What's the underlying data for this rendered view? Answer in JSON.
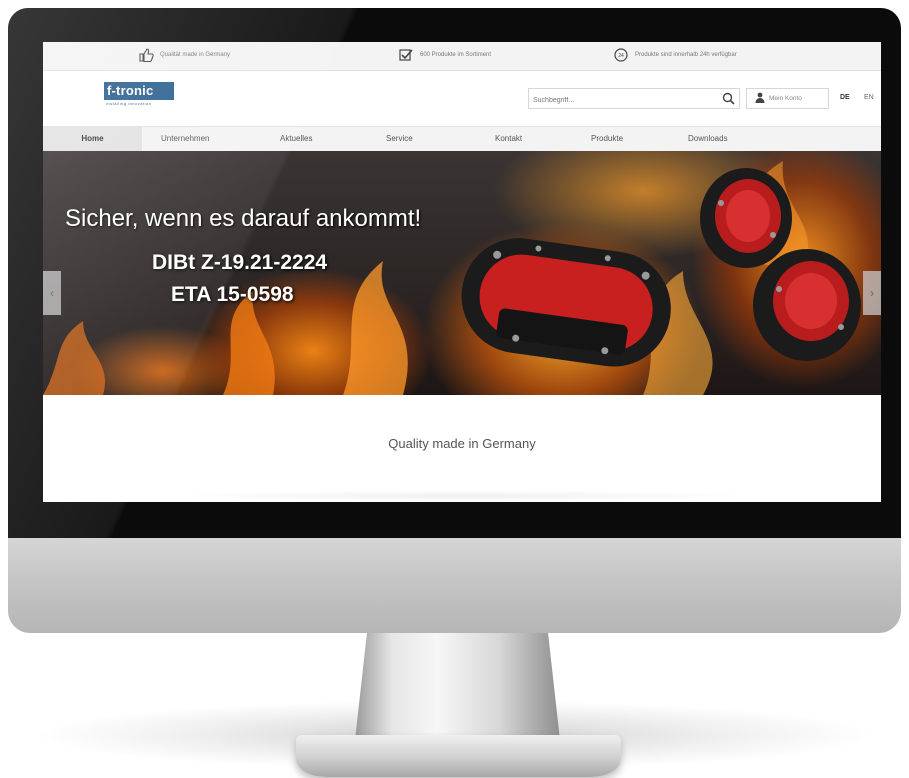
{
  "usps": [
    {
      "icon": "thumbs-up-icon",
      "text": "Qualität made in Germany"
    },
    {
      "icon": "checkbox-icon",
      "text": "600 Produkte im Sortiment"
    },
    {
      "icon": "clock-24h-icon",
      "text": "Produkte sind innerhalb 24h verfügbar"
    }
  ],
  "header": {
    "logo_text": "f-tronic",
    "logo_sub": "installing innovation",
    "search_placeholder": "Suchbegriff...",
    "account_label": "Mein Konto",
    "languages": [
      "DE",
      "EN"
    ]
  },
  "nav": {
    "items": [
      "Home",
      "Unternehmen",
      "Aktuelles",
      "Service",
      "Kontakt",
      "Produkte",
      "Downloads"
    ],
    "active": "Home"
  },
  "hero": {
    "headline": "Sicher, wenn es darauf ankommt!",
    "line1": "DIBt Z-19.21-2224",
    "line2": "ETA 15-0598",
    "prev": "‹",
    "next": "›"
  },
  "section": {
    "tagline": "Quality made in Germany"
  },
  "colors": {
    "brand": "#2a5f8e",
    "box_red": "#d32222",
    "box_black": "#1b1b1b"
  }
}
